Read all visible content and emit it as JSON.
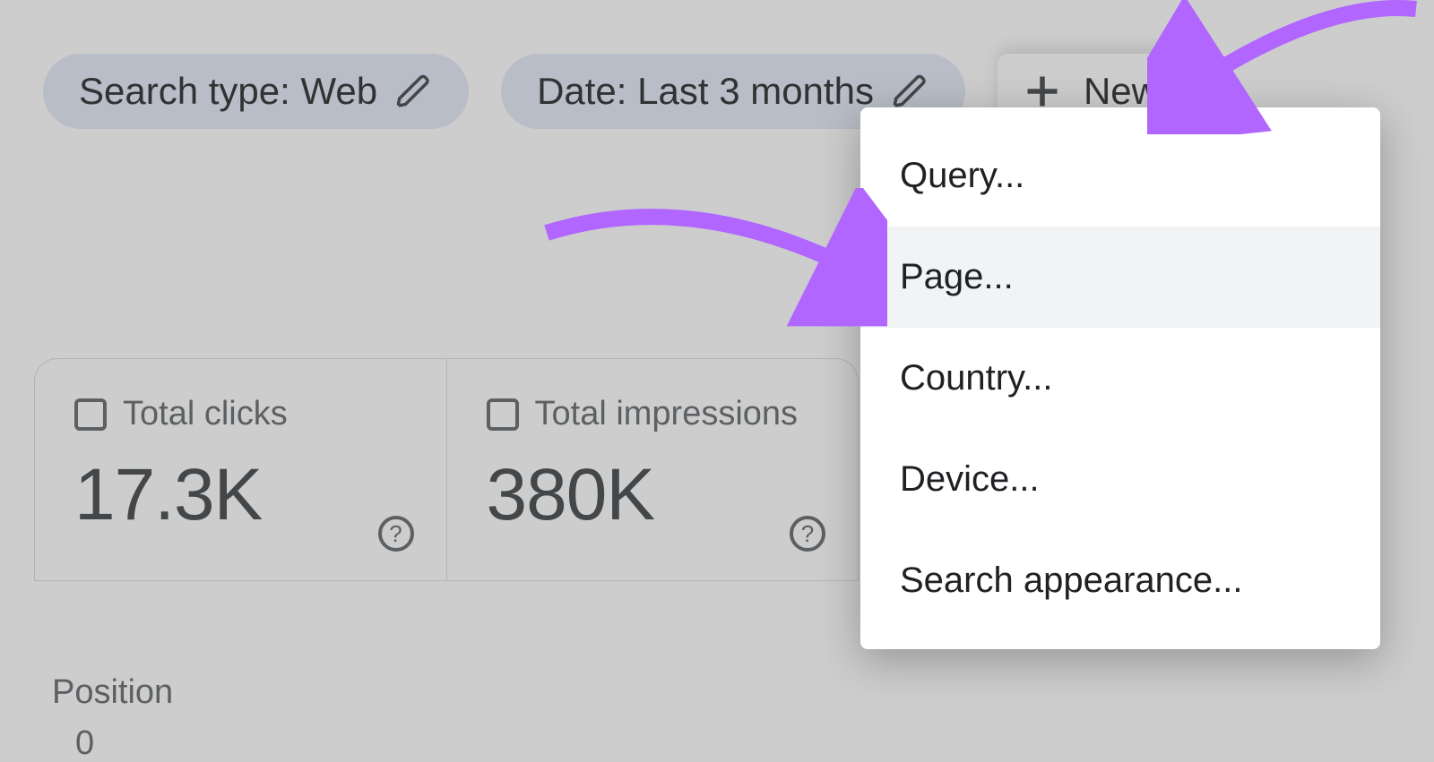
{
  "filters": {
    "search_type": {
      "label": "Search type: Web"
    },
    "date": {
      "label": "Date: Last 3 months"
    },
    "new": {
      "label": "New"
    }
  },
  "menu": {
    "items": [
      {
        "label": "Query..."
      },
      {
        "label": "Page..."
      },
      {
        "label": "Country..."
      },
      {
        "label": "Device..."
      },
      {
        "label": "Search appearance..."
      }
    ]
  },
  "cards": {
    "clicks": {
      "label": "Total clicks",
      "value": "17.3K"
    },
    "impressions": {
      "label": "Total impressions",
      "value": "380K"
    }
  },
  "axis": {
    "label": "Position",
    "tick0": "0"
  },
  "colors": {
    "annotation": "#b066ff"
  }
}
